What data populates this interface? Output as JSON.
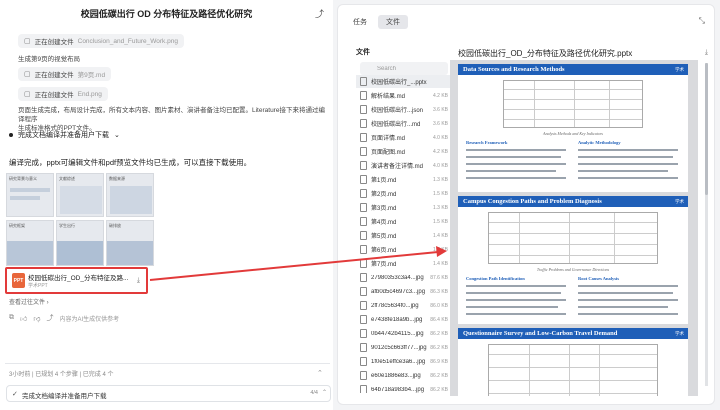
{
  "left": {
    "title": "校园低碳出行 OD 分布特征及路径优化研究",
    "chips": [
      {
        "label": "正在创建文件",
        "file": "Conclusion_and_Future_Work.png"
      },
      {
        "label": "正在创建文件",
        "file": "第9页.md"
      },
      {
        "label": "正在创建文件",
        "file": "End.png"
      }
    ],
    "layout_text": "生成第9页的视觉布局",
    "summary_lines": [
      "页面生成完成，布局设计完成，所有文本内容、图片素材、演讲者备注均已配置。Literature接下来将通过编译程序",
      "生成标准格式的PPT文件。"
    ],
    "bullet": "完成文档编译并准备用户下载",
    "done_message": "编译完成，pptx可编辑文件和pdf预览文件均已生成，可以直接下载使用。",
    "thumb_labels": [
      "研究背景与意义",
      "文献综述",
      "数据来源",
      "研究框架",
      "学生出行",
      "碳排放"
    ],
    "file_card": {
      "name": "校园低碳出行_OD_分布特征及路...",
      "sub": "学术PPT",
      "ext": "PPT"
    },
    "all_files": "查看过往文件 ›",
    "feedback": "内容为AI生成仅供参考",
    "status": "3小时前 | 已规划 4 个步骤 | 已完成 4 个",
    "task": {
      "title": "完成文档编译并准备用户下载",
      "count": "4/4"
    }
  },
  "right": {
    "tabs": [
      "任务",
      "文件"
    ],
    "files_head": "文件",
    "search_placeholder": "Search",
    "doc_title": "校园低碳出行_OD_分布特征及路径优化研究.pptx",
    "files": [
      {
        "name": "校园低碳出行_...pptx",
        "size": ""
      },
      {
        "name": "解析结果.md",
        "size": "4.2 KB"
      },
      {
        "name": "校园低碳出行...json",
        "size": "3.6 KB"
      },
      {
        "name": "校园低碳出行...md",
        "size": "3.6 KB"
      },
      {
        "name": "页面详情.md",
        "size": "4.0 KB"
      },
      {
        "name": "页面配图.md",
        "size": "4.2 KB"
      },
      {
        "name": "演讲者备注详情.md",
        "size": "4.0 KB"
      },
      {
        "name": "第1页.md",
        "size": "1.3 KB"
      },
      {
        "name": "第2页.md",
        "size": "1.5 KB"
      },
      {
        "name": "第3页.md",
        "size": "1.3 KB"
      },
      {
        "name": "第4页.md",
        "size": "1.5 KB"
      },
      {
        "name": "第5页.md",
        "size": "1.4 KB"
      },
      {
        "name": "第6页.md",
        "size": "1.5 KB"
      },
      {
        "name": "第7页.md",
        "size": "1.4 KB"
      },
      {
        "name": "27980353c3a4...jpg",
        "size": "87.6 KB"
      },
      {
        "name": "afb0d5c4697c3...jpg",
        "size": "86.3 KB"
      },
      {
        "name": "2ff78c5634f0...jpg",
        "size": "86.0 KB"
      },
      {
        "name": "e7438fe18a9b...jpg",
        "size": "86.4 KB"
      },
      {
        "name": "0b44742b4115...jpg",
        "size": "86.2 KB"
      },
      {
        "name": "9012c5c663ff77...jpg",
        "size": "86.2 KB"
      },
      {
        "name": "1f0e51effce3a6...jpg",
        "size": "86.9 KB"
      },
      {
        "name": "e60e1886e83...jpg",
        "size": "86.2 KB"
      },
      {
        "name": "64b718a983b4...jpg",
        "size": "86.2 KB"
      }
    ],
    "slides": [
      {
        "title": "Data Sources and Research Methods",
        "sub1": "Research Framework",
        "sub2": "Analytic Methodology",
        "caption": "Analysis Methods and Key Indicators"
      },
      {
        "title": "Campus Congestion Paths and Problem Diagnosis",
        "sub1": "Congestion Path Identification",
        "sub2": "Root Causes Analysis",
        "caption": "Traffic Problems and Governance Directions"
      },
      {
        "title": "Questionnaire Survey and Low-Carbon Travel Demand",
        "sub1": "",
        "sub2": "",
        "caption": ""
      }
    ],
    "logo_text": "学术"
  }
}
